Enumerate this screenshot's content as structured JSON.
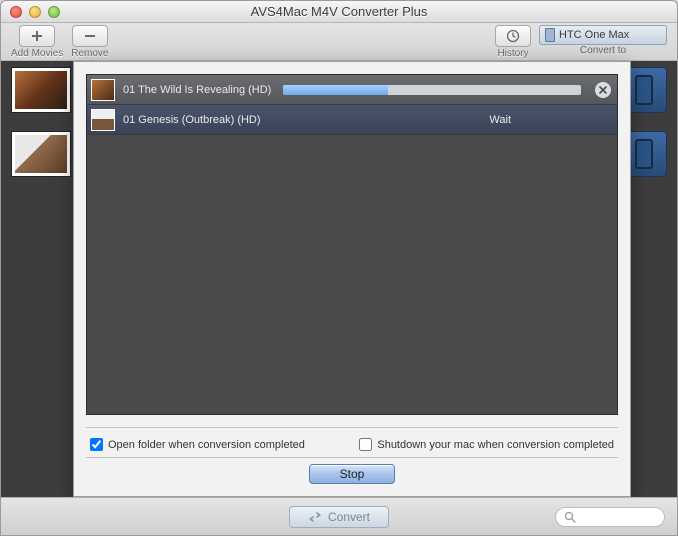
{
  "app": {
    "title": "AVS4Mac M4V Converter Plus"
  },
  "toolbar": {
    "add_label": "Add Movies",
    "remove_label": "Remove",
    "history_label": "History",
    "convert_to_label": "Convert to",
    "device": "HTC One Max"
  },
  "queue": [
    {
      "title": "01 The Wild Is Revealing (HD)",
      "status": "progress",
      "progress_pct": 35
    },
    {
      "title": "01 Genesis (Outbreak) (HD)",
      "status": "Wait"
    }
  ],
  "modal": {
    "open_folder_label": "Open folder when conversion completed",
    "open_folder_checked": true,
    "shutdown_label": "Shutdown your mac when conversion completed",
    "shutdown_checked": false,
    "stop_label": "Stop"
  },
  "footer": {
    "convert_label": "Convert",
    "search_placeholder": ""
  },
  "colors": {
    "accent": "#8fb1e0"
  }
}
